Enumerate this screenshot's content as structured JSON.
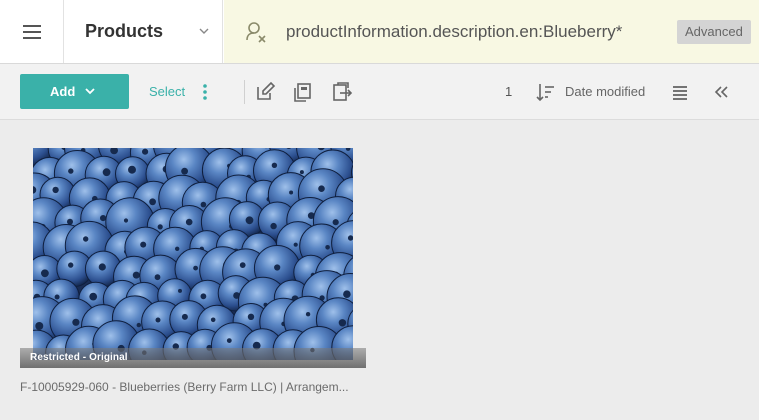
{
  "header": {
    "menu_icon": "hamburger-menu-icon",
    "section_label": "Products",
    "search": {
      "icon": "search-user-clear-icon",
      "value": "productInformation.description.en:Blueberry*",
      "advanced_label": "Advanced"
    }
  },
  "toolbar": {
    "add_label": "Add",
    "select_label": "Select",
    "icons": [
      "edit-icon",
      "copy-icon",
      "export-icon"
    ],
    "result_count": "1",
    "sort_label": "Date modified",
    "accent_color": "#3ab1a9"
  },
  "results": [
    {
      "status": "Restricted - Original",
      "caption": "F-10005929-060 - Blueberries (Berry Farm LLC) | Arrangem..."
    }
  ]
}
